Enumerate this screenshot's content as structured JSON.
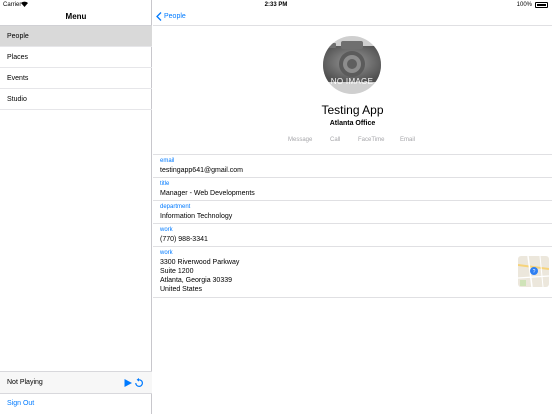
{
  "status_bar": {
    "carrier": "Carrier",
    "time": "2:33 PM",
    "battery": "100%"
  },
  "sidebar": {
    "title": "Menu",
    "items": [
      {
        "label": "People",
        "selected": true
      },
      {
        "label": "Places",
        "selected": false
      },
      {
        "label": "Events",
        "selected": false
      },
      {
        "label": "Studio",
        "selected": false
      }
    ],
    "player_status": "Not Playing",
    "sign_out": "Sign Out"
  },
  "detail": {
    "back_label": "People",
    "avatar_placeholder": "NO IMAGE",
    "name": "Testing App",
    "company": "Atlanta Office",
    "actions": [
      "Message",
      "Call",
      "FaceTime",
      "Email"
    ],
    "fields": [
      {
        "label": "email",
        "value": "testingapp641@gmail.com"
      },
      {
        "label": "title",
        "value": "Manager - Web Developments"
      },
      {
        "label": "department",
        "value": "Information Technology"
      },
      {
        "label": "work",
        "value": "(770) 988-3341"
      },
      {
        "label": "work",
        "address_lines": [
          "3300 Riverwood Parkway",
          "Suite 1200",
          "Atlanta, Georgia  30339",
          "United States"
        ]
      }
    ]
  },
  "colors": {
    "accent": "#007aff",
    "selected_row": "#d9d9d9",
    "action_gray": "#a6a6aa"
  }
}
